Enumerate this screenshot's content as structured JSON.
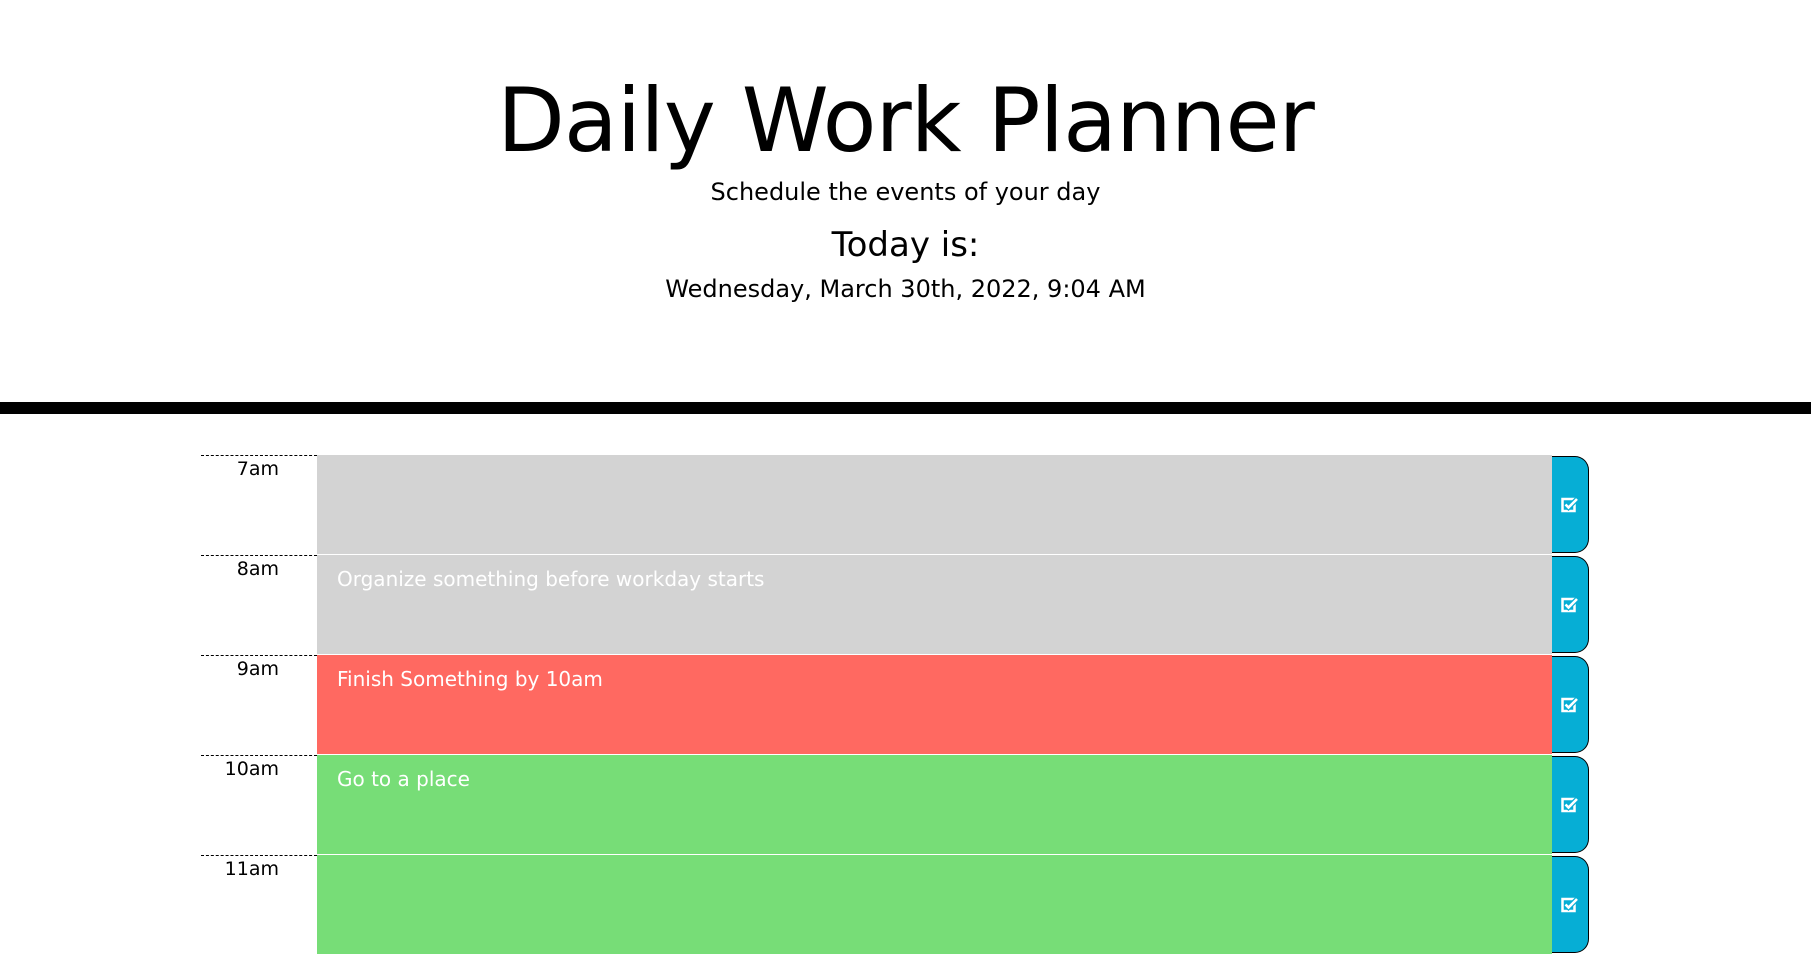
{
  "header": {
    "title": "Daily Work Planner",
    "subtitle": "Schedule the events of your day",
    "today_label": "Today is:",
    "current_date": "Wednesday, March 30th, 2022, 9:04 AM"
  },
  "colors": {
    "past": "#d3d3d3",
    "present": "#ff6961",
    "future": "#77dd77",
    "save_button": "#06aed5"
  },
  "time_blocks": [
    {
      "hour": "7am",
      "text": "",
      "status": "past",
      "save_icon": "check-square-icon"
    },
    {
      "hour": "8am",
      "text": "Organize something before workday starts",
      "status": "past",
      "save_icon": "check-square-icon"
    },
    {
      "hour": "9am",
      "text": "Finish Something by 10am",
      "status": "present",
      "save_icon": "check-square-icon"
    },
    {
      "hour": "10am",
      "text": "Go to a place",
      "status": "future",
      "save_icon": "check-square-icon"
    },
    {
      "hour": "11am",
      "text": "",
      "status": "future",
      "save_icon": "check-square-icon"
    }
  ]
}
